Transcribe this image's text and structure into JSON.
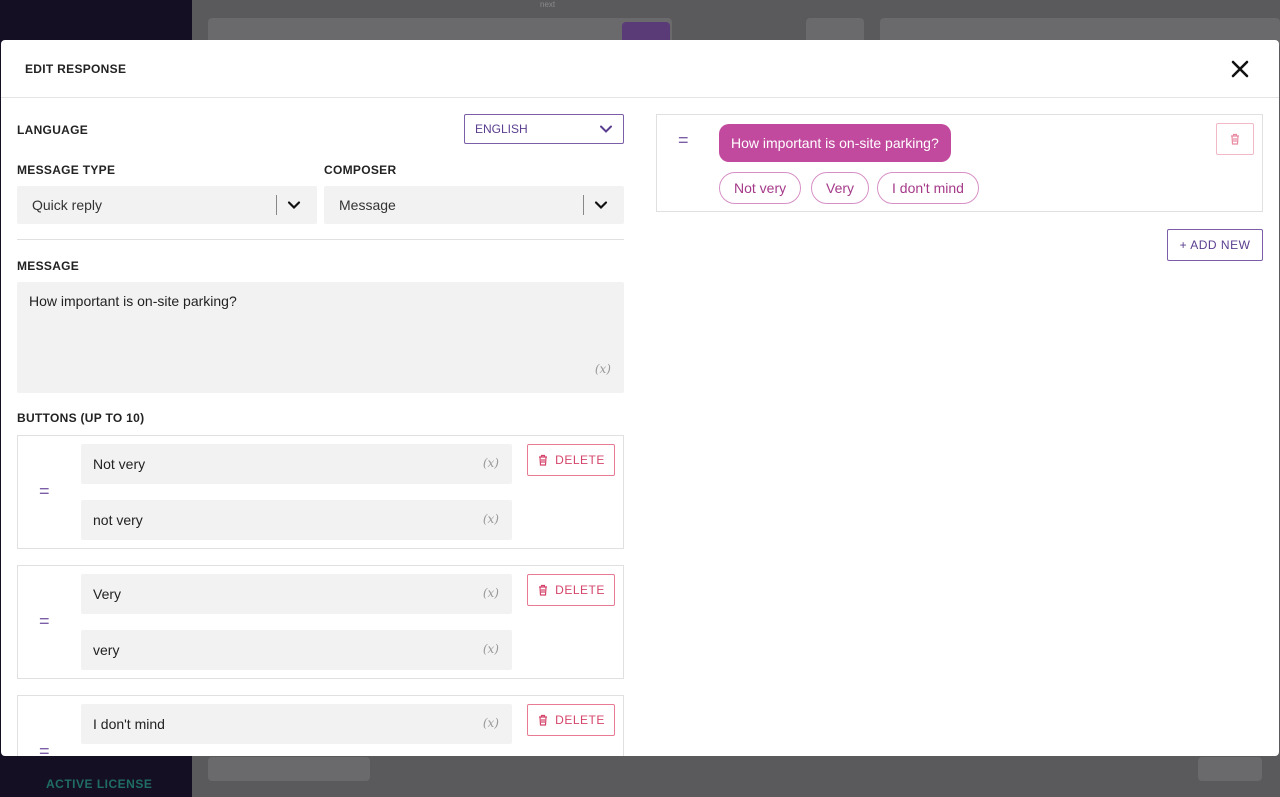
{
  "background": {
    "license_label": "ACTIVE LICENSE",
    "next_label": "next"
  },
  "modal": {
    "title": "EDIT RESPONSE"
  },
  "form": {
    "language_label": "LANGUAGE",
    "language_value": "ENGLISH",
    "message_type_label": "MESSAGE TYPE",
    "message_type_value": "Quick reply",
    "composer_label": "COMPOSER",
    "composer_value": "Message",
    "message_label": "MESSAGE",
    "message_value": "How important is on-site parking?",
    "buttons_label": "BUTTONS (UP TO 10)",
    "variable_tag": "(x)",
    "delete_label": "DELETE",
    "buttons": [
      {
        "title": "Not very",
        "payload": "not very"
      },
      {
        "title": "Very",
        "payload": "very"
      },
      {
        "title": "I don't mind",
        "payload": ""
      }
    ]
  },
  "preview": {
    "message": "How important is on-site parking?",
    "chips": [
      "Not very",
      "Very",
      "I don't mind"
    ],
    "add_new_label": "+ ADD NEW"
  },
  "colors": {
    "accent": "#7b5ea7",
    "bubble": "#c24a9e",
    "danger": "#d4446a"
  }
}
